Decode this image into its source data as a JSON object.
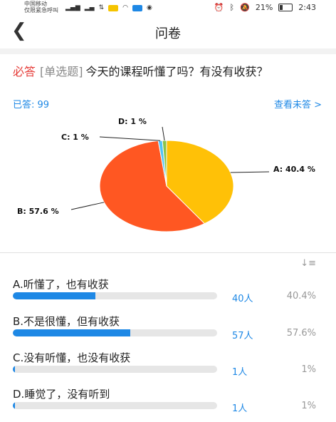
{
  "status_bar": {
    "carrier_line1": "中国移动",
    "carrier_line2": "仅限紧急呼叫",
    "battery_pct": "21%",
    "time": "2:43"
  },
  "header": {
    "title": "问卷",
    "back_icon": "chevron-left-icon"
  },
  "question": {
    "required_tag": "必答",
    "type_tag": "[单选题]",
    "text": "今天的课程听懂了吗？有没有收获？",
    "answered": "已答: 99",
    "view_unanswered": "查看未答 >"
  },
  "chart_data": {
    "type": "pie",
    "slices": [
      {
        "label": "A",
        "value": 40.4,
        "display": "A: 40.4 %",
        "color": "#ffc107"
      },
      {
        "label": "B",
        "value": 57.6,
        "display": "B: 57.6 %",
        "color": "#ff5722"
      },
      {
        "label": "C",
        "value": 1,
        "display": "C: 1 %",
        "color": "#4fc3f7"
      },
      {
        "label": "D",
        "value": 1,
        "display": "D: 1 %",
        "color": "#8bc34a"
      }
    ]
  },
  "options": [
    {
      "label": "A.听懂了，也有收获",
      "count": "40人",
      "percent": "40.4%",
      "fraction": 0.404
    },
    {
      "label": "B.不是很懂，但有收获",
      "count": "57人",
      "percent": "57.6%",
      "fraction": 0.576
    },
    {
      "label": "C.没有听懂，也没有收获",
      "count": "1人",
      "percent": "1%",
      "fraction": 0.01
    },
    {
      "label": "D.睡觉了，没有听到",
      "count": "1人",
      "percent": "1%",
      "fraction": 0.01
    }
  ],
  "colors": {
    "accent": "#1e88e5",
    "required": "#e53935"
  }
}
